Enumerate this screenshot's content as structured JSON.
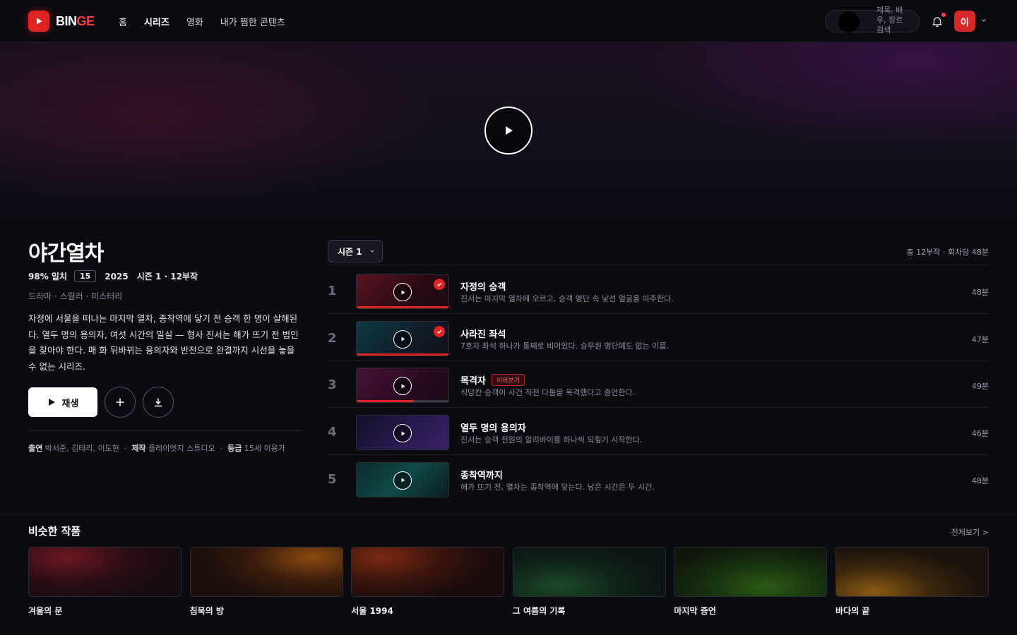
{
  "header": {
    "logo_part1": "BIN",
    "logo_part2": "GE",
    "nav": [
      "홈",
      "시리즈",
      "영화",
      "내가 찜한 콘텐츠"
    ],
    "active_nav": "시리즈",
    "search_placeholder": "제목, 배우, 장르 검색",
    "avatar_initial": "이"
  },
  "show": {
    "title": "야간열차",
    "match": "98% 일치",
    "rating": "15",
    "year": "2025",
    "season_info": "시즌 1 · 12부작",
    "genres": "드라마 · 스릴러 · 미스터리",
    "description": "자정에 서울을 떠나는 마지막 열차, 종착역에 닿기 전 승객 한 명이 살해된다. 열두 명의 용의자, 여섯 시간의 밀실 — 형사 진서는 해가 뜨기 전 범인을 찾아야 한다. 매 화 뒤바뀌는 용의자와 반전으로 완결까지 시선을 놓을 수 없는 시리즈.",
    "play_label": "재생",
    "cast_label": "출연",
    "cast": "박서준, 김테리, 이도현",
    "producer_label": "제작",
    "producer": "플레이엣지 스튜디오",
    "grade_label": "등급",
    "grade": "15세 이용가"
  },
  "episodes_panel": {
    "season_select": "시즌 1",
    "total": "총 12부작 · 회차당 48분",
    "episodes": [
      {
        "num": "1",
        "title": "자정의 승객",
        "desc": "진서는 마지막 열차에 오르고, 승객 명단 속 낯선 얼굴을 마주한다.",
        "duration": "48분",
        "watched": true,
        "progress": 1.0,
        "badge": ""
      },
      {
        "num": "2",
        "title": "사라진 좌석",
        "desc": "7호차 좌석 하나가 통째로 비어있다. 승무원 명단에도 없는 이름.",
        "duration": "47분",
        "watched": true,
        "progress": 1.0,
        "badge": ""
      },
      {
        "num": "3",
        "title": "목격자",
        "desc": "식당칸 승객이 사건 직전 다툼을 목격했다고 증언한다.",
        "duration": "49분",
        "watched": false,
        "progress": 0.62,
        "badge": "이어보기"
      },
      {
        "num": "4",
        "title": "열두 명의 용의자",
        "desc": "진서는 승객 전원의 알리바이를 하나씩 되짚기 시작한다.",
        "duration": "46분",
        "watched": false,
        "progress": 0,
        "badge": ""
      },
      {
        "num": "5",
        "title": "종착역까지",
        "desc": "해가 뜨기 전, 열차는 종착역에 닿는다. 남은 시간은 두 시간.",
        "duration": "48분",
        "watched": false,
        "progress": 0,
        "badge": ""
      }
    ]
  },
  "similar": {
    "title": "비슷한 작품",
    "see_all": "전체보기 >",
    "items": [
      "겨울의 문",
      "침묵의 방",
      "서울 1994",
      "그 여름의 기록",
      "마지막 증언",
      "바다의 끝"
    ]
  },
  "colors": {
    "accent": "#e02424",
    "background": "#0b0b12"
  }
}
